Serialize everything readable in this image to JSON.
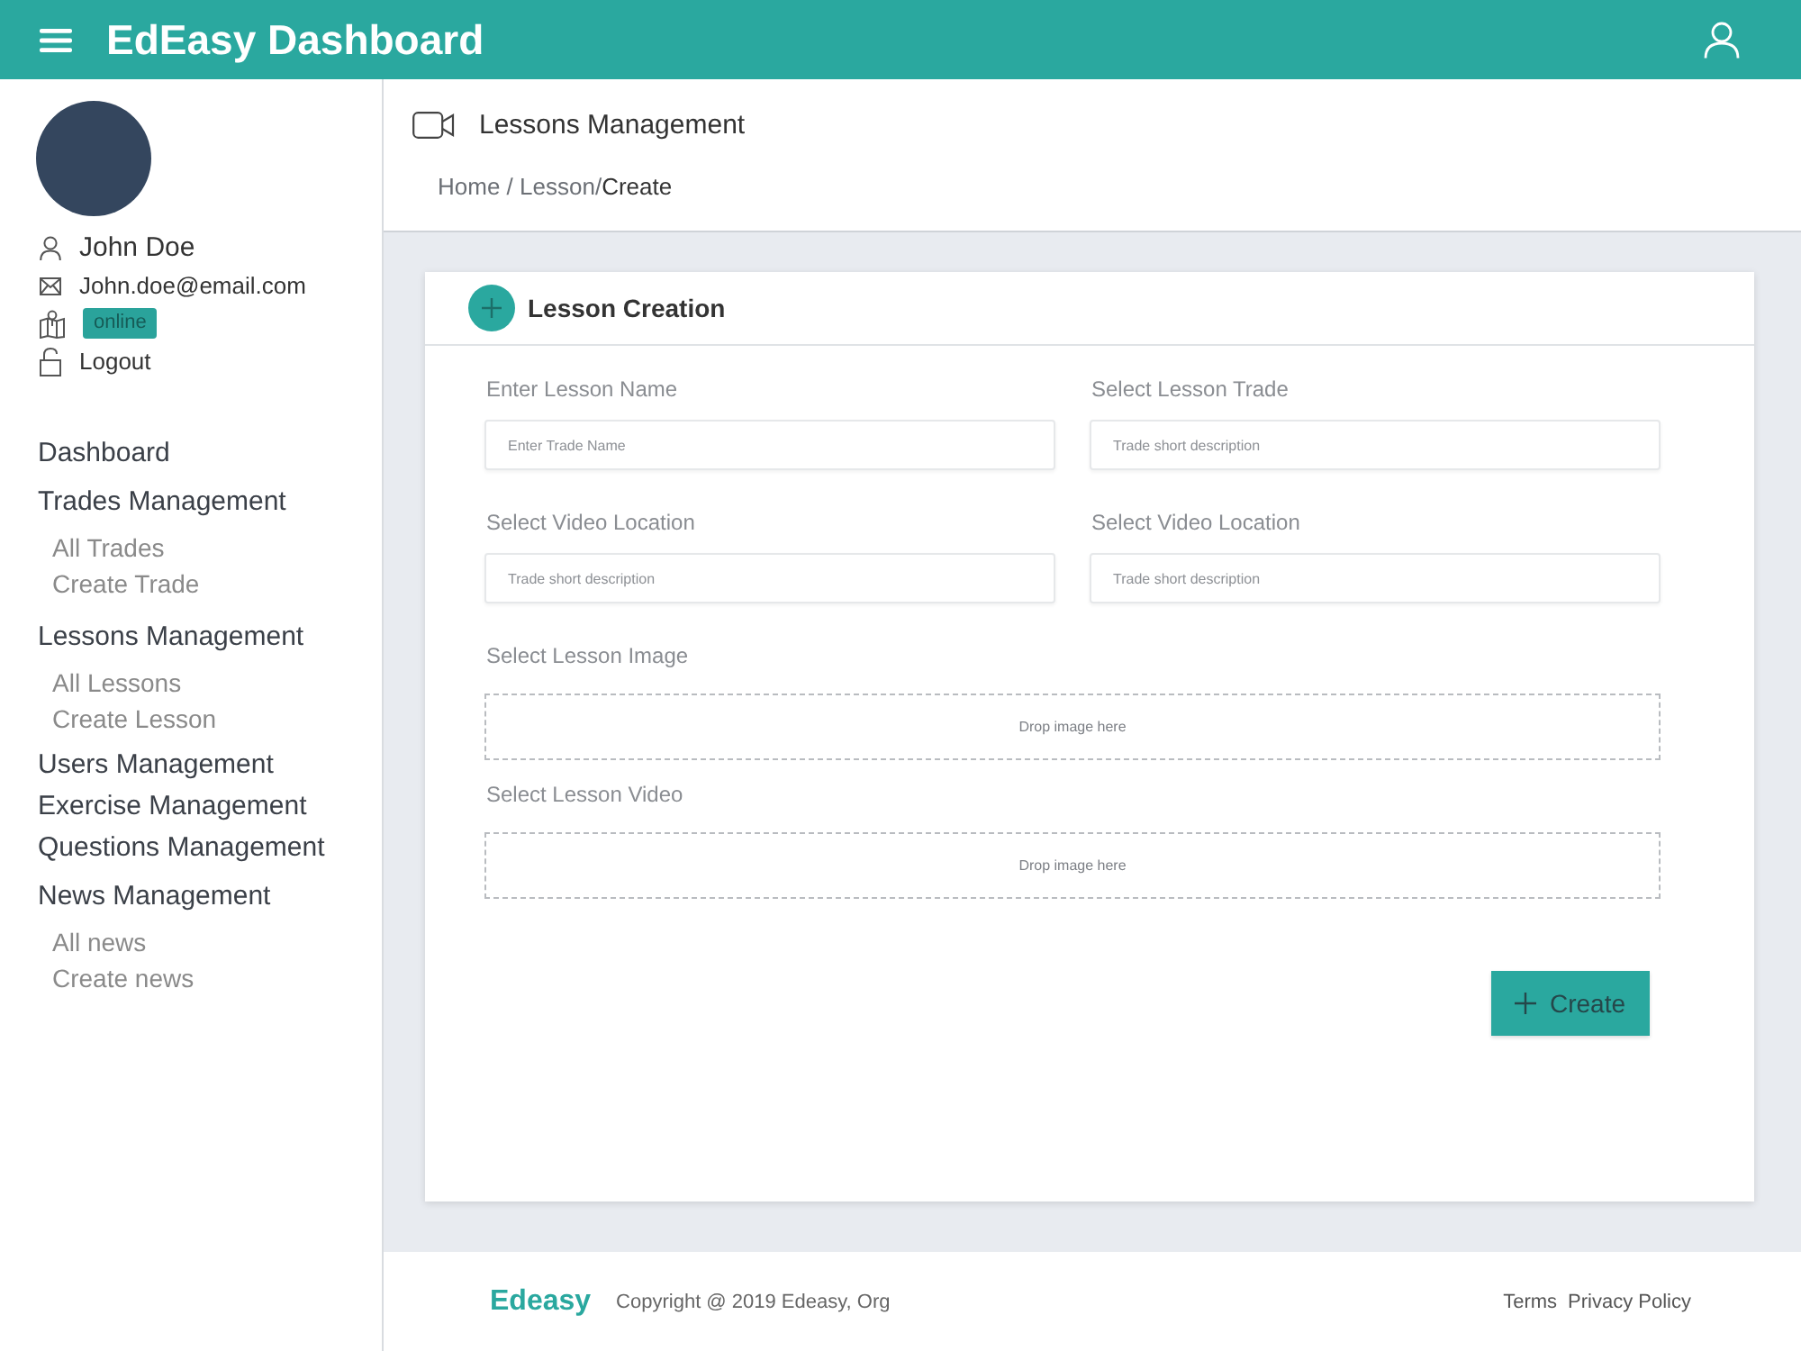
{
  "topbar": {
    "title": "EdEasy Dashboard"
  },
  "profile": {
    "name": "John Doe",
    "email": "John.doe@email.com",
    "status": "online",
    "logout": "Logout"
  },
  "sidebar": {
    "items": [
      {
        "label": "Dashboard"
      },
      {
        "label": "Trades Management",
        "children": [
          {
            "label": "All Trades"
          },
          {
            "label": "Create Trade"
          }
        ]
      },
      {
        "label": "Lessons Management",
        "children": [
          {
            "label": "All Lessons"
          },
          {
            "label": "Create Lesson"
          }
        ]
      },
      {
        "label": "Users Management"
      },
      {
        "label": "Exercise Management"
      },
      {
        "label": "Questions Management"
      },
      {
        "label": "News Management",
        "children": [
          {
            "label": "All news"
          },
          {
            "label": "Create news"
          }
        ]
      }
    ]
  },
  "page_header": {
    "title": "Lessons Management",
    "breadcrumb": [
      {
        "kind": "link",
        "text": "Home"
      },
      {
        "kind": "separator",
        "text": " / "
      },
      {
        "kind": "link",
        "text": "Lesson"
      },
      {
        "kind": "separator",
        "text": "/"
      },
      {
        "kind": "current",
        "text": "Create"
      }
    ]
  },
  "lesson_form": {
    "title": "Lesson Creation",
    "fields": [
      {
        "kind": "input",
        "label": "Enter Lesson Name",
        "placeholder": "Enter Trade Name"
      },
      {
        "kind": "input",
        "label": "Select Lesson Trade",
        "placeholder": "Trade short description"
      },
      {
        "kind": "input",
        "label": "Select Video Location",
        "placeholder": "Trade short description"
      },
      {
        "kind": "input",
        "label": "Select Video Location",
        "placeholder": "Trade short description"
      },
      {
        "kind": "dropzone",
        "label": "Select Lesson Image",
        "prompt": "Drop image here"
      },
      {
        "kind": "dropzone",
        "label": "Select Lesson Video",
        "prompt": "Drop image here"
      }
    ],
    "submit": "Create"
  },
  "footer": {
    "brand": "Edeasy",
    "copyright": "Copyright @ 2019 Edeasy, Org",
    "links": [
      "Terms",
      "Privacy Policy"
    ]
  }
}
